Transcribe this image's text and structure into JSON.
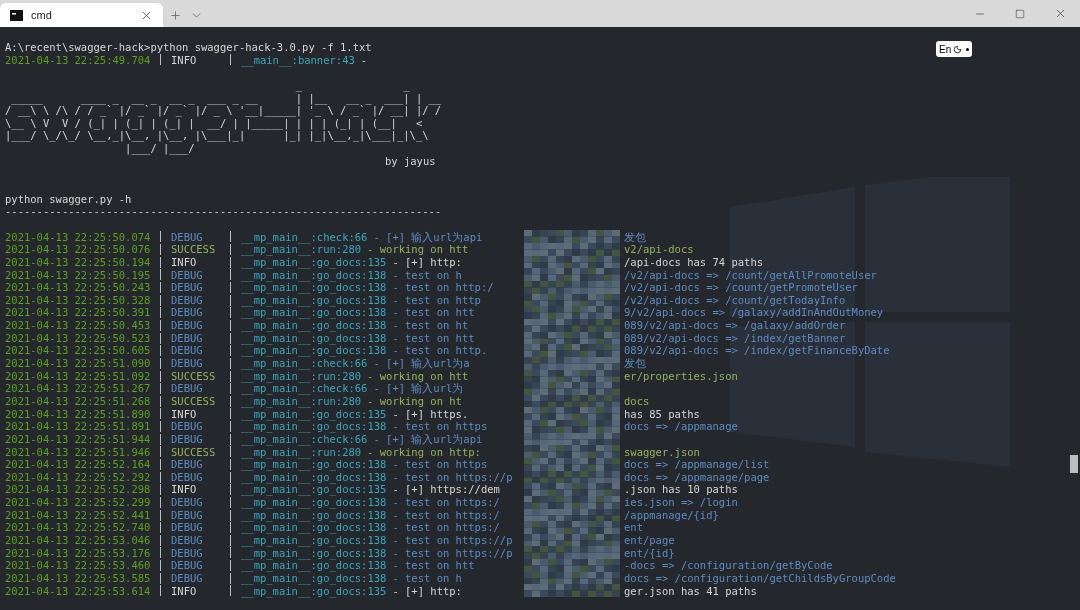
{
  "window": {
    "tab_title": "cmd"
  },
  "input_indicator": {
    "label": "En"
  },
  "command": "A:\\recent\\swagger-hack>python swagger-hack-3.0.py -f 1.txt",
  "banner_log": {
    "time": "2021-04-13 22:25:49.704",
    "level": "INFO",
    "kind": "info",
    "source": "__main__:banner:43",
    "message": "-"
  },
  "banner_art": [
    "                                              _                _",
    " _____      ____ _  __ _  __ _  ___ _ __      | |__   __ _  ___| | __",
    "/ __\\ \\ /\\ / / _` |/ _` |/ _` |/ _ \\ '__|_____| '_ \\ / _` |/ __| |/ /",
    "\\__ \\ V  V / (_| | (_| | (_| |  __/ | |_____| | | | (_| | (__|   <",
    "|___/ \\_/\\_/ \\__,_|\\__, |\\__, |\\___|_|      |_| |_|\\__,_|\\___|_|\\_\\",
    "                   |___/ |___/"
  ],
  "banner_author": "by jayus",
  "usage": "python swagger.py -h",
  "rule": "---------------------------------------------------------------------",
  "logs": [
    {
      "time": "2021-04-13 22:25:50.074",
      "level": "DEBUG",
      "kind": "debug",
      "source": "__mp_main__:check:66",
      "message": "- [+] 输入url为api",
      "message_end": "发包"
    },
    {
      "time": "2021-04-13 22:25:50.076",
      "level": "SUCCESS",
      "kind": "success",
      "source": "__mp_main__:run:280",
      "message": "- working on htt",
      "message_end": "v2/api-docs"
    },
    {
      "time": "2021-04-13 22:25:50.194",
      "level": "INFO",
      "kind": "info",
      "source": "__mp_main__:go_docs:135",
      "message": "- [+] http:",
      "message_end": "/api-docs has 74 paths"
    },
    {
      "time": "2021-04-13 22:25:50.195",
      "level": "DEBUG",
      "kind": "debug",
      "source": "__mp_main__:go_docs:138",
      "message": "- test on h",
      "message_end": "/v2/api-docs => /count/getAllPromoteUser"
    },
    {
      "time": "2021-04-13 22:25:50.243",
      "level": "DEBUG",
      "kind": "debug",
      "source": "__mp_main__:go_docs:138",
      "message": "- test on http:/",
      "message_end": "/v2/api-docs => /count/getPromoteUser"
    },
    {
      "time": "2021-04-13 22:25:50.328",
      "level": "DEBUG",
      "kind": "debug",
      "source": "__mp_main__:go_docs:138",
      "message": "- test on http",
      "message_end": "/v2/api-docs => /count/getTodayInfo"
    },
    {
      "time": "2021-04-13 22:25:50.391",
      "level": "DEBUG",
      "kind": "debug",
      "source": "__mp_main__:go_docs:138",
      "message": "- test on htt",
      "message_end": "9/v2/api-docs => /galaxy/addInAndOutMoney"
    },
    {
      "time": "2021-04-13 22:25:50.453",
      "level": "DEBUG",
      "kind": "debug",
      "source": "__mp_main__:go_docs:138",
      "message": "- test on ht",
      "message_end": "089/v2/api-docs => /galaxy/addOrder"
    },
    {
      "time": "2021-04-13 22:25:50.523",
      "level": "DEBUG",
      "kind": "debug",
      "source": "__mp_main__:go_docs:138",
      "message": "- test on htt",
      "message_end": "089/v2/api-docs => /index/getBanner"
    },
    {
      "time": "2021-04-13 22:25:50.605",
      "level": "DEBUG",
      "kind": "debug",
      "source": "__mp_main__:go_docs:138",
      "message": "- test on http.",
      "message_end": "089/v2/api-docs => /index/getFinanceByDate"
    },
    {
      "time": "2021-04-13 22:25:51.090",
      "level": "DEBUG",
      "kind": "debug",
      "source": "__mp_main__:check:66",
      "message": "- [+] 输入url为a",
      "message_end": "发包"
    },
    {
      "time": "2021-04-13 22:25:51.092",
      "level": "SUCCESS",
      "kind": "success",
      "source": "__mp_main__:run:280",
      "message": "- working on htt",
      "message_end": "er/properties.json"
    },
    {
      "time": "2021-04-13 22:25:51.267",
      "level": "DEBUG",
      "kind": "debug",
      "source": "__mp_main__:check:66",
      "message": "- [+] 输入url为"
    },
    {
      "time": "2021-04-13 22:25:51.268",
      "level": "SUCCESS",
      "kind": "success",
      "source": "__mp_main__:run:280",
      "message": "- working on ht",
      "message_end": "docs"
    },
    {
      "time": "2021-04-13 22:25:51.890",
      "level": "INFO",
      "kind": "info",
      "source": "__mp_main__:go_docs:135",
      "message": "- [+] https.",
      "message_end": "has 85 paths"
    },
    {
      "time": "2021-04-13 22:25:51.891",
      "level": "DEBUG",
      "kind": "debug",
      "source": "__mp_main__:go_docs:138",
      "message": "- test on https",
      "message_end": "docs => /appmanage"
    },
    {
      "time": "2021-04-13 22:25:51.944",
      "level": "DEBUG",
      "kind": "debug",
      "source": "__mp_main__:check:66",
      "message": "- [+] 输入url为api"
    },
    {
      "time": "2021-04-13 22:25:51.946",
      "level": "SUCCESS",
      "kind": "success",
      "source": "__mp_main__:run:280",
      "message": "- working on http:",
      "message_end": "swagger.json"
    },
    {
      "time": "2021-04-13 22:25:52.164",
      "level": "DEBUG",
      "kind": "debug",
      "source": "__mp_main__:go_docs:138",
      "message": "- test on https",
      "message_end": "docs => /appmanage/list"
    },
    {
      "time": "2021-04-13 22:25:52.292",
      "level": "DEBUG",
      "kind": "debug",
      "source": "__mp_main__:go_docs:138",
      "message": "- test on https://p",
      "message_end": "docs => /appmanage/page"
    },
    {
      "time": "2021-04-13 22:25:52.298",
      "level": "INFO",
      "kind": "info",
      "source": "__mp_main__:go_docs:135",
      "message": "- [+] https://dem",
      "message_end": ".json has 10 paths"
    },
    {
      "time": "2021-04-13 22:25:52.299",
      "level": "DEBUG",
      "kind": "debug",
      "source": "__mp_main__:go_docs:138",
      "message": "- test on https:/",
      "message_end": "ies.json => /login"
    },
    {
      "time": "2021-04-13 22:25:52.441",
      "level": "DEBUG",
      "kind": "debug",
      "source": "__mp_main__:go_docs:138",
      "message": "- test on https:/",
      "message_end": "/appmanage/{id}"
    },
    {
      "time": "2021-04-13 22:25:52.740",
      "level": "DEBUG",
      "kind": "debug",
      "source": "__mp_main__:go_docs:138",
      "message": "- test on https:/",
      "message_end": "ent"
    },
    {
      "time": "2021-04-13 22:25:53.046",
      "level": "DEBUG",
      "kind": "debug",
      "source": "__mp_main__:go_docs:138",
      "message": "- test on https://p",
      "message_end": "ent/page"
    },
    {
      "time": "2021-04-13 22:25:53.176",
      "level": "DEBUG",
      "kind": "debug",
      "source": "__mp_main__:go_docs:138",
      "message": "- test on https://p",
      "message_end": "ent/{id}"
    },
    {
      "time": "2021-04-13 22:25:53.460",
      "level": "DEBUG",
      "kind": "debug",
      "source": "__mp_main__:go_docs:138",
      "message": "- test on htt",
      "message_end": "-docs => /configuration/getByCode"
    },
    {
      "time": "2021-04-13 22:25:53.585",
      "level": "DEBUG",
      "kind": "debug",
      "source": "__mp_main__:go_docs:138",
      "message": "- test on h",
      "message_end": "docs => /configuration/getChildsByGroupCode"
    },
    {
      "time": "2021-04-13 22:25:53.614",
      "level": "INFO",
      "kind": "info",
      "source": "__mp_main__:go_docs:135",
      "message": "- [+] http:",
      "message_end": "ger.json has 41 paths"
    }
  ]
}
